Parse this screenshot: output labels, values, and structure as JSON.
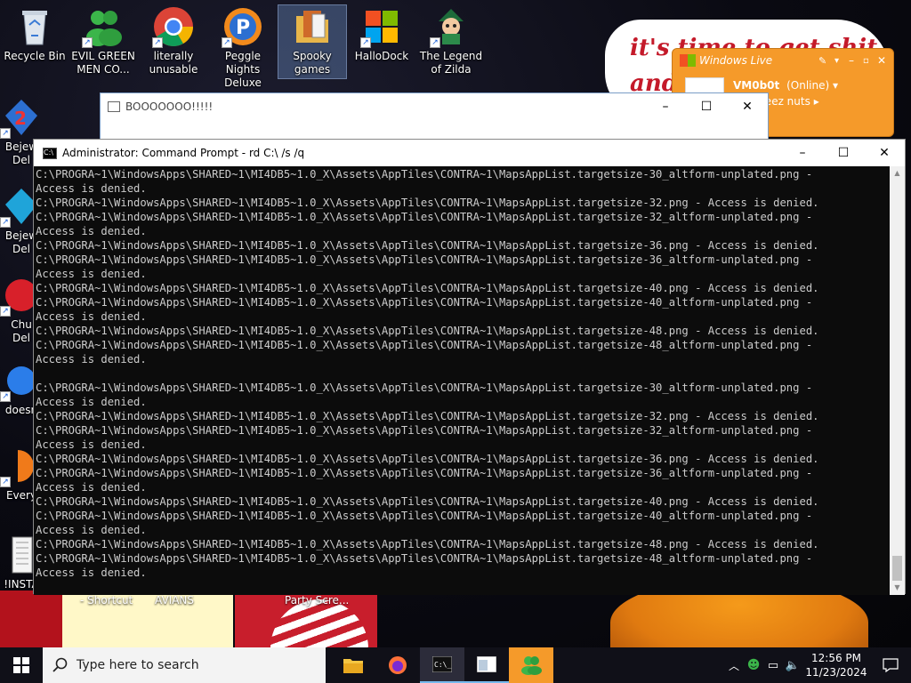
{
  "desktop": {
    "icons": [
      {
        "label": "Recycle Bin",
        "icon": "recycle-bin-icon"
      },
      {
        "label": "EVIL GREEN\nMEN CO...",
        "icon": "green-men-icon"
      },
      {
        "label": "literally\nunusable",
        "icon": "chrome-icon"
      },
      {
        "label": "Peggle Nights\nDeluxe",
        "icon": "peggle-icon"
      },
      {
        "label": "Spooky\ngames",
        "icon": "folder-icon"
      },
      {
        "label": "HalloDock",
        "icon": "windows-logo-icon"
      },
      {
        "label": "The Legend\nof Zilda",
        "icon": "zilda-icon"
      }
    ],
    "left_icons": [
      {
        "label": "Bejew\nDel",
        "icon": "bejeweled-icon"
      },
      {
        "label": "Bejew\nDel",
        "icon": "bejeweled-icon"
      },
      {
        "label": "Chu\nDel",
        "icon": "chuzzle-icon"
      },
      {
        "label": "doesn",
        "icon": "app-icon"
      },
      {
        "label": "Every",
        "icon": "app-icon"
      },
      {
        "label": "!INSTA",
        "icon": "installer-icon"
      }
    ],
    "bottom_labels": [
      "- Shortcut",
      "AVIANS",
      "Party Scre..."
    ],
    "wallpaper_text": "it's time to get shit\nand"
  },
  "messenger": {
    "title": "Windows Live",
    "user": "VM0b0t",
    "status": "(Online)",
    "message": "rate deez nuts"
  },
  "bg_window": {
    "title": "BOOOOOOO!!!!!"
  },
  "cmd": {
    "title": "Administrator: Command Prompt - rd  C:\\ /s /q",
    "lines": [
      "C:\\PROGRA~1\\WindowsApps\\SHARED~1\\MI4DB5~1.0_X\\Assets\\AppTiles\\CONTRA~1\\MapsAppList.targetsize-30_altform-unplated.png -",
      "Access is denied.",
      "C:\\PROGRA~1\\WindowsApps\\SHARED~1\\MI4DB5~1.0_X\\Assets\\AppTiles\\CONTRA~1\\MapsAppList.targetsize-32.png - Access is denied.",
      "C:\\PROGRA~1\\WindowsApps\\SHARED~1\\MI4DB5~1.0_X\\Assets\\AppTiles\\CONTRA~1\\MapsAppList.targetsize-32_altform-unplated.png -",
      "Access is denied.",
      "C:\\PROGRA~1\\WindowsApps\\SHARED~1\\MI4DB5~1.0_X\\Assets\\AppTiles\\CONTRA~1\\MapsAppList.targetsize-36.png - Access is denied.",
      "C:\\PROGRA~1\\WindowsApps\\SHARED~1\\MI4DB5~1.0_X\\Assets\\AppTiles\\CONTRA~1\\MapsAppList.targetsize-36_altform-unplated.png -",
      "Access is denied.",
      "C:\\PROGRA~1\\WindowsApps\\SHARED~1\\MI4DB5~1.0_X\\Assets\\AppTiles\\CONTRA~1\\MapsAppList.targetsize-40.png - Access is denied.",
      "C:\\PROGRA~1\\WindowsApps\\SHARED~1\\MI4DB5~1.0_X\\Assets\\AppTiles\\CONTRA~1\\MapsAppList.targetsize-40_altform-unplated.png -",
      "Access is denied.",
      "C:\\PROGRA~1\\WindowsApps\\SHARED~1\\MI4DB5~1.0_X\\Assets\\AppTiles\\CONTRA~1\\MapsAppList.targetsize-48.png - Access is denied.",
      "C:\\PROGRA~1\\WindowsApps\\SHARED~1\\MI4DB5~1.0_X\\Assets\\AppTiles\\CONTRA~1\\MapsAppList.targetsize-48_altform-unplated.png -",
      "Access is denied.",
      "",
      "C:\\PROGRA~1\\WindowsApps\\SHARED~1\\MI4DB5~1.0_X\\Assets\\AppTiles\\CONTRA~1\\MapsAppList.targetsize-30_altform-unplated.png -",
      "Access is denied.",
      "C:\\PROGRA~1\\WindowsApps\\SHARED~1\\MI4DB5~1.0_X\\Assets\\AppTiles\\CONTRA~1\\MapsAppList.targetsize-32.png - Access is denied.",
      "C:\\PROGRA~1\\WindowsApps\\SHARED~1\\MI4DB5~1.0_X\\Assets\\AppTiles\\CONTRA~1\\MapsAppList.targetsize-32_altform-unplated.png -",
      "Access is denied.",
      "C:\\PROGRA~1\\WindowsApps\\SHARED~1\\MI4DB5~1.0_X\\Assets\\AppTiles\\CONTRA~1\\MapsAppList.targetsize-36.png - Access is denied.",
      "C:\\PROGRA~1\\WindowsApps\\SHARED~1\\MI4DB5~1.0_X\\Assets\\AppTiles\\CONTRA~1\\MapsAppList.targetsize-36_altform-unplated.png -",
      "Access is denied.",
      "C:\\PROGRA~1\\WindowsApps\\SHARED~1\\MI4DB5~1.0_X\\Assets\\AppTiles\\CONTRA~1\\MapsAppList.targetsize-40.png - Access is denied.",
      "C:\\PROGRA~1\\WindowsApps\\SHARED~1\\MI4DB5~1.0_X\\Assets\\AppTiles\\CONTRA~1\\MapsAppList.targetsize-40_altform-unplated.png -",
      "Access is denied.",
      "C:\\PROGRA~1\\WindowsApps\\SHARED~1\\MI4DB5~1.0_X\\Assets\\AppTiles\\CONTRA~1\\MapsAppList.targetsize-48.png - Access is denied.",
      "C:\\PROGRA~1\\WindowsApps\\SHARED~1\\MI4DB5~1.0_X\\Assets\\AppTiles\\CONTRA~1\\MapsAppList.targetsize-48_altform-unplated.png -",
      "Access is denied."
    ]
  },
  "taskbar": {
    "search_placeholder": "Type here to search",
    "time": "12:56 PM",
    "date": "11/23/2024"
  },
  "colors": {
    "messenger_orange": "#f59a2a",
    "console_bg": "#0c0c0c",
    "console_fg": "#cccccc"
  }
}
